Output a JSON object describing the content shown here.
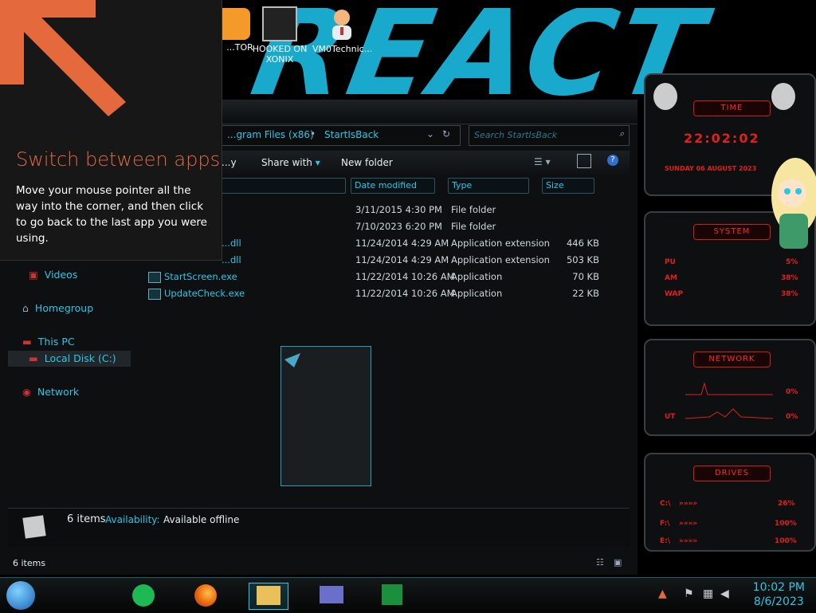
{
  "desktop": {
    "icons": [
      {
        "label": "...TOR",
        "name": "desktop-icon-tor"
      },
      {
        "label": "HOOKED ON XONIX",
        "name": "desktop-icon-hooked-on-xonix"
      },
      {
        "label": "VM0Technic...",
        "name": "desktop-icon-vm0technic"
      }
    ],
    "wallpaper_text": "REACT"
  },
  "tip": {
    "title": "Switch between apps",
    "body": "Move your mouse pointer all the way into the corner, and then click to go back to the last app you were using."
  },
  "explorer": {
    "address": {
      "segments": [
        "...gram Files (x86)",
        "StartIsBack"
      ]
    },
    "search": {
      "placeholder": "Search StartIsBack"
    },
    "toolbar": {
      "organize": "...y",
      "share_with": "Share with",
      "new_folder": "New folder"
    },
    "columns": {
      "name": "",
      "date_modified": "Date modified",
      "type": "Type",
      "size": "Size"
    },
    "files": [
      {
        "name": "",
        "date": "3/11/2015 4:30 PM",
        "type": "File folder",
        "size": ""
      },
      {
        "name": "",
        "date": "7/10/2023 6:20 PM",
        "type": "File folder",
        "size": ""
      },
      {
        "name": "...dll",
        "date": "11/24/2014 4:29 AM",
        "type": "Application extension",
        "size": "446 KB"
      },
      {
        "name": "...dll",
        "date": "11/24/2014 4:29 AM",
        "type": "Application extension",
        "size": "503 KB"
      },
      {
        "name": "StartScreen.exe",
        "date": "11/22/2014 10:26 AM",
        "type": "Application",
        "size": "70 KB"
      },
      {
        "name": "UpdateCheck.exe",
        "date": "11/22/2014 10:26 AM",
        "type": "Application",
        "size": "22 KB"
      }
    ],
    "nav": {
      "pictures": "Pictures",
      "videos": "Videos",
      "homegroup": "Homegroup",
      "this_pc": "This PC",
      "local_disk": "Local Disk (C:)",
      "network": "Network"
    },
    "details": {
      "count": "6 items",
      "availability_label": "Availability:",
      "availability_value": "Available offline"
    },
    "status": {
      "count": "6 items"
    }
  },
  "gadgets": {
    "time": {
      "title": "TIME",
      "clock": "22:02:02",
      "date": "SUNDAY 06 AUGUST 2023"
    },
    "system": {
      "title": "SYSTEM",
      "cpu_label": "PU",
      "cpu": "5%",
      "ram_label": "AM",
      "ram": "38%",
      "swap_label": "WAP",
      "swap": "38%"
    },
    "network": {
      "title": "NETWORK",
      "in": "0%",
      "out_label": "UT",
      "out": "0%"
    },
    "drives": {
      "title": "DRIVES",
      "c_label": "C:\\",
      "c": "26%",
      "f_label": "F:\\",
      "f": "100%",
      "e_label": "E:\\",
      "e": "100%"
    }
  },
  "taskbar": {
    "time": "10:02 PM",
    "date": "8/6/2023"
  },
  "colors": {
    "accent": "#2ec6e6",
    "tip_title": "#e46a3e",
    "gadget_red": "#ff2a2a"
  }
}
